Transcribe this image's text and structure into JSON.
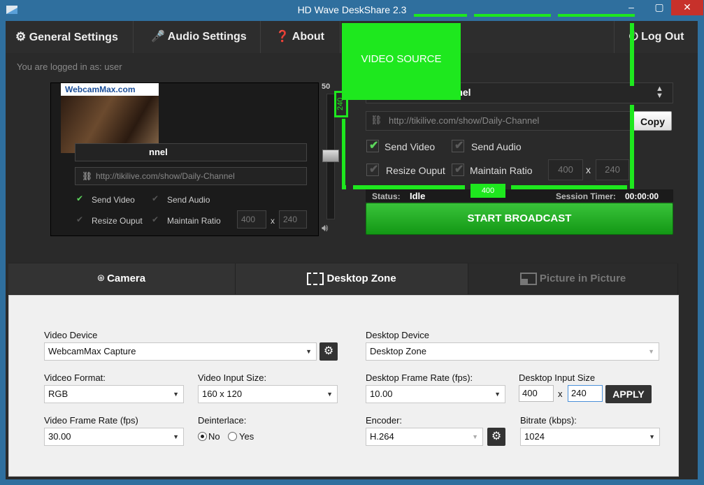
{
  "window": {
    "title": "HD Wave DeskShare 2.3",
    "minimize": "–",
    "maximize": "▢",
    "close": "✕"
  },
  "menu": {
    "general_settings": "General Settings",
    "audio_settings": "Audio Settings",
    "about": "About",
    "logout": "Log Out"
  },
  "session": {
    "logged_in_label": "You are logged in as:",
    "username": "user"
  },
  "preview": {
    "webcam_logo": "WebcamMax.com",
    "channel_text": "nnel",
    "url": "http://tikilive.com/show/Daily-Channel",
    "send_video": "Send Video",
    "send_audio": "Send Audio",
    "resize_output": "Resize Ouput",
    "maintain_ratio": "Maintain Ratio",
    "width": "400",
    "x": "x",
    "height": "240"
  },
  "volume": {
    "max_label": "50",
    "level": 0.5
  },
  "broadcast": {
    "channel_select": "annel",
    "url": "http://tikilive.com/show/Daily-Channel",
    "copy_label": "Copy",
    "send_video": "Send Video",
    "send_video_checked": true,
    "send_audio": "Send Audio",
    "send_audio_checked": false,
    "resize_output": "Resize Ouput",
    "maintain_ratio": "Maintain Ratio",
    "width": "400",
    "x": "x",
    "height": "240",
    "status_label": "Status:",
    "status_value": "Idle",
    "timer_label": "Session Timer:",
    "timer_value": "00:00:00",
    "start_label": "START BROADCAST"
  },
  "overlay": {
    "label": "VIDEO SOURCE",
    "height_label": "240",
    "width_label": "400",
    "color": "#1ee81e"
  },
  "tabs": [
    {
      "label": "Camera",
      "icon": "webcam-icon"
    },
    {
      "label": "Desktop Zone",
      "icon": "desktop-zone-icon"
    },
    {
      "label": "Picture in Picture",
      "icon": "pip-icon"
    }
  ],
  "camera_panel": {
    "video_device_label": "Video Device",
    "video_device_value": "WebcamMax Capture",
    "video_format_label": "Vidceo Format:",
    "video_format_value": "RGB",
    "input_size_label": "Video Input Size:",
    "input_size_value": "160 x 120",
    "frame_rate_label": "Video Frame Rate (fps)",
    "frame_rate_value": "30.00",
    "deinterlace_label": "Deinterlace:",
    "deinterlace_no": "No",
    "deinterlace_yes": "Yes"
  },
  "desktop_panel": {
    "device_label": "Desktop Device",
    "device_value": "Desktop Zone",
    "frame_rate_label": "Desktop Frame Rate (fps):",
    "frame_rate_value": "10.00",
    "input_size_label": "Desktop Input Size",
    "width": "400",
    "x": "x",
    "height": "240",
    "apply_label": "APPLY",
    "encoder_label": "Encoder:",
    "encoder_value": "H.264",
    "bitrate_label": "Bitrate (kbps):",
    "bitrate_value": "1024"
  }
}
